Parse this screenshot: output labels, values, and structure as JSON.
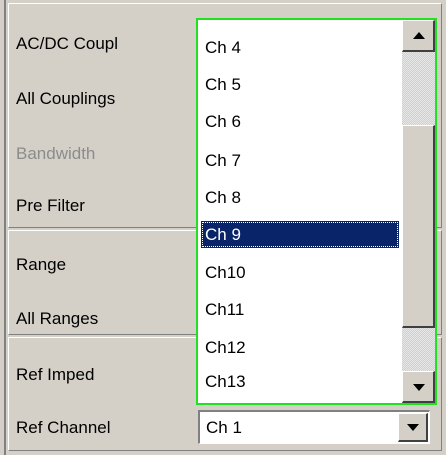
{
  "labels": {
    "acdc": "AC/DC Coupl",
    "all_couplings": "All Couplings",
    "bandwidth": "Bandwidth",
    "pre_filter": "Pre Filter",
    "range": "Range",
    "all_ranges": "All Ranges",
    "ref_imped": "Ref Imped",
    "ref_channel": "Ref Channel"
  },
  "dropdown_list": {
    "items": [
      "Ch 4",
      "Ch 5",
      "Ch 6",
      "Ch 7",
      "Ch 8",
      "Ch 9",
      "Ch10",
      "Ch11",
      "Ch12",
      "Ch13"
    ],
    "selected": "Ch 9"
  },
  "ref_channel_combo": {
    "value": "Ch 1"
  },
  "icons": {
    "scroll_up": "triangle-up-icon",
    "scroll_down": "triangle-down-icon",
    "combo_arrow": "triangle-down-icon"
  },
  "colors": {
    "panel": "#d4d0c8",
    "focus_border": "#22e022",
    "selection": "#0a246a",
    "disabled_text": "#8c8c8c"
  }
}
